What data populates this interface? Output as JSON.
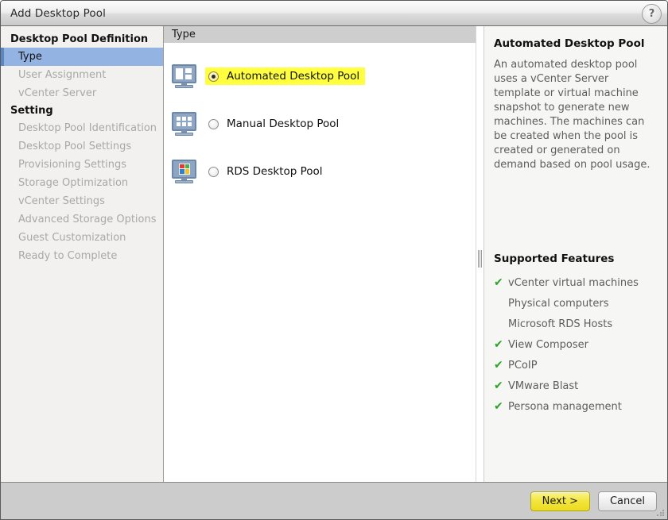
{
  "window": {
    "title": "Add Desktop Pool",
    "help_icon": "question-mark-icon"
  },
  "sidebar": {
    "groups": [
      {
        "label": "Desktop Pool Definition",
        "items": [
          {
            "label": "Type",
            "state": "active"
          },
          {
            "label": "User Assignment",
            "state": "disabled"
          },
          {
            "label": "vCenter Server",
            "state": "disabled"
          }
        ]
      },
      {
        "label": "Setting",
        "items": [
          {
            "label": "Desktop Pool Identification",
            "state": "disabled"
          },
          {
            "label": "Desktop Pool Settings",
            "state": "disabled"
          },
          {
            "label": "Provisioning Settings",
            "state": "disabled"
          },
          {
            "label": "Storage Optimization",
            "state": "disabled"
          },
          {
            "label": "vCenter Settings",
            "state": "disabled"
          },
          {
            "label": "Advanced Storage Options",
            "state": "disabled"
          },
          {
            "label": "Guest Customization",
            "state": "disabled"
          },
          {
            "label": "Ready to Complete",
            "state": "disabled"
          }
        ]
      }
    ]
  },
  "main": {
    "section_title": "Type",
    "options": [
      {
        "label": "Automated Desktop Pool",
        "selected": true,
        "highlighted": true,
        "icon": "monitor-panels-icon"
      },
      {
        "label": "Manual Desktop Pool",
        "selected": false,
        "highlighted": false,
        "icon": "monitor-grid-icon"
      },
      {
        "label": "RDS Desktop Pool",
        "selected": false,
        "highlighted": false,
        "icon": "monitor-windows-flag-icon"
      }
    ]
  },
  "info": {
    "title": "Automated Desktop Pool",
    "description": "An automated desktop pool uses a vCenter Server template or virtual machine snapshot to generate new machines. The machines can be created when the pool is created or generated on demand based on pool usage.",
    "features_title": "Supported Features",
    "features": [
      {
        "label": "vCenter virtual machines",
        "supported": true
      },
      {
        "label": "Physical computers",
        "supported": false
      },
      {
        "label": "Microsoft RDS Hosts",
        "supported": false
      },
      {
        "label": "View Composer",
        "supported": true
      },
      {
        "label": "PCoIP",
        "supported": true
      },
      {
        "label": "VMware Blast",
        "supported": true
      },
      {
        "label": "Persona management",
        "supported": true
      }
    ],
    "check_glyph": "✔"
  },
  "footer": {
    "next_label": "Next >",
    "cancel_label": "Cancel"
  },
  "colors": {
    "highlight": "#ffff40",
    "selection": "#93b3e2",
    "check_green": "#2ba325",
    "primary_button": "#f2e53c"
  }
}
